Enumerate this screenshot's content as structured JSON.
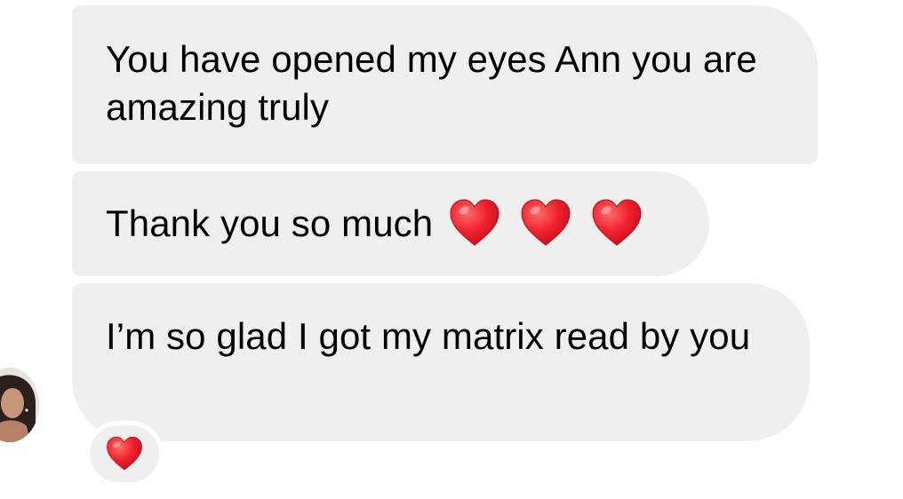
{
  "messages": [
    {
      "text": "You have opened my eyes Ann you are amazing truly"
    },
    {
      "text": "Thank you so much",
      "emojis": [
        "red-heart",
        "red-heart",
        "red-heart"
      ]
    },
    {
      "text": "I’m so glad I got my matrix read by you"
    }
  ],
  "reaction": {
    "emoji": "red-heart"
  },
  "colors": {
    "bubble_bg": "#efefef",
    "heart": "#f0202d",
    "text": "#000000"
  }
}
